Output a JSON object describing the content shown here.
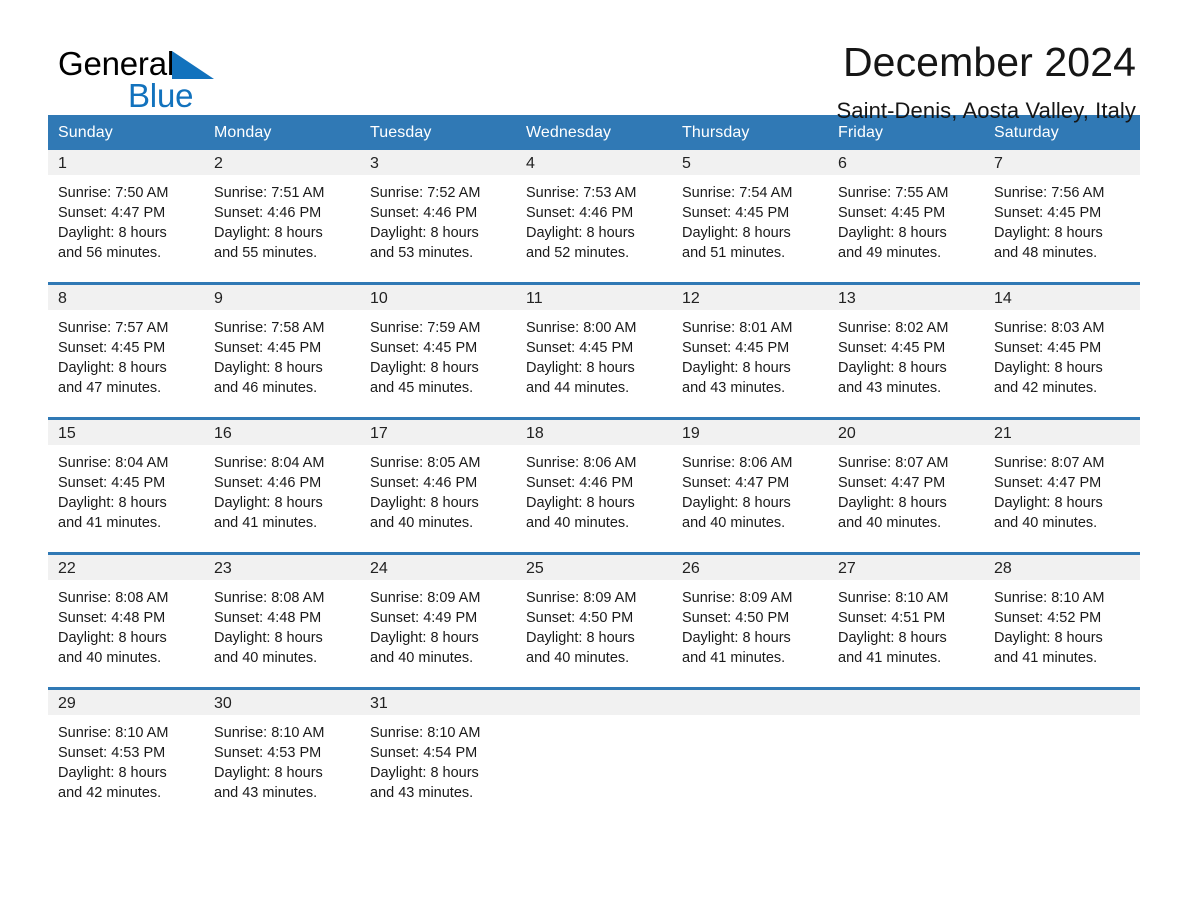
{
  "brand": {
    "name_part1": "General",
    "name_part2": "Blue",
    "accent_color": "#1272bd"
  },
  "header": {
    "title": "December 2024",
    "subtitle": "Saint-Denis, Aosta Valley, Italy"
  },
  "theme": {
    "header_row_color": "#3079b5",
    "day_band_color": "#f1f1f1",
    "rule_color": "#3079b5"
  },
  "calendar": {
    "weekday_headers": [
      "Sunday",
      "Monday",
      "Tuesday",
      "Wednesday",
      "Thursday",
      "Friday",
      "Saturday"
    ],
    "weeks": [
      [
        {
          "day": "1",
          "sunrise": "Sunrise: 7:50 AM",
          "sunset": "Sunset: 4:47 PM",
          "daylight_line1": "Daylight: 8 hours",
          "daylight_line2": "and 56 minutes."
        },
        {
          "day": "2",
          "sunrise": "Sunrise: 7:51 AM",
          "sunset": "Sunset: 4:46 PM",
          "daylight_line1": "Daylight: 8 hours",
          "daylight_line2": "and 55 minutes."
        },
        {
          "day": "3",
          "sunrise": "Sunrise: 7:52 AM",
          "sunset": "Sunset: 4:46 PM",
          "daylight_line1": "Daylight: 8 hours",
          "daylight_line2": "and 53 minutes."
        },
        {
          "day": "4",
          "sunrise": "Sunrise: 7:53 AM",
          "sunset": "Sunset: 4:46 PM",
          "daylight_line1": "Daylight: 8 hours",
          "daylight_line2": "and 52 minutes."
        },
        {
          "day": "5",
          "sunrise": "Sunrise: 7:54 AM",
          "sunset": "Sunset: 4:45 PM",
          "daylight_line1": "Daylight: 8 hours",
          "daylight_line2": "and 51 minutes."
        },
        {
          "day": "6",
          "sunrise": "Sunrise: 7:55 AM",
          "sunset": "Sunset: 4:45 PM",
          "daylight_line1": "Daylight: 8 hours",
          "daylight_line2": "and 49 minutes."
        },
        {
          "day": "7",
          "sunrise": "Sunrise: 7:56 AM",
          "sunset": "Sunset: 4:45 PM",
          "daylight_line1": "Daylight: 8 hours",
          "daylight_line2": "and 48 minutes."
        }
      ],
      [
        {
          "day": "8",
          "sunrise": "Sunrise: 7:57 AM",
          "sunset": "Sunset: 4:45 PM",
          "daylight_line1": "Daylight: 8 hours",
          "daylight_line2": "and 47 minutes."
        },
        {
          "day": "9",
          "sunrise": "Sunrise: 7:58 AM",
          "sunset": "Sunset: 4:45 PM",
          "daylight_line1": "Daylight: 8 hours",
          "daylight_line2": "and 46 minutes."
        },
        {
          "day": "10",
          "sunrise": "Sunrise: 7:59 AM",
          "sunset": "Sunset: 4:45 PM",
          "daylight_line1": "Daylight: 8 hours",
          "daylight_line2": "and 45 minutes."
        },
        {
          "day": "11",
          "sunrise": "Sunrise: 8:00 AM",
          "sunset": "Sunset: 4:45 PM",
          "daylight_line1": "Daylight: 8 hours",
          "daylight_line2": "and 44 minutes."
        },
        {
          "day": "12",
          "sunrise": "Sunrise: 8:01 AM",
          "sunset": "Sunset: 4:45 PM",
          "daylight_line1": "Daylight: 8 hours",
          "daylight_line2": "and 43 minutes."
        },
        {
          "day": "13",
          "sunrise": "Sunrise: 8:02 AM",
          "sunset": "Sunset: 4:45 PM",
          "daylight_line1": "Daylight: 8 hours",
          "daylight_line2": "and 43 minutes."
        },
        {
          "day": "14",
          "sunrise": "Sunrise: 8:03 AM",
          "sunset": "Sunset: 4:45 PM",
          "daylight_line1": "Daylight: 8 hours",
          "daylight_line2": "and 42 minutes."
        }
      ],
      [
        {
          "day": "15",
          "sunrise": "Sunrise: 8:04 AM",
          "sunset": "Sunset: 4:45 PM",
          "daylight_line1": "Daylight: 8 hours",
          "daylight_line2": "and 41 minutes."
        },
        {
          "day": "16",
          "sunrise": "Sunrise: 8:04 AM",
          "sunset": "Sunset: 4:46 PM",
          "daylight_line1": "Daylight: 8 hours",
          "daylight_line2": "and 41 minutes."
        },
        {
          "day": "17",
          "sunrise": "Sunrise: 8:05 AM",
          "sunset": "Sunset: 4:46 PM",
          "daylight_line1": "Daylight: 8 hours",
          "daylight_line2": "and 40 minutes."
        },
        {
          "day": "18",
          "sunrise": "Sunrise: 8:06 AM",
          "sunset": "Sunset: 4:46 PM",
          "daylight_line1": "Daylight: 8 hours",
          "daylight_line2": "and 40 minutes."
        },
        {
          "day": "19",
          "sunrise": "Sunrise: 8:06 AM",
          "sunset": "Sunset: 4:47 PM",
          "daylight_line1": "Daylight: 8 hours",
          "daylight_line2": "and 40 minutes."
        },
        {
          "day": "20",
          "sunrise": "Sunrise: 8:07 AM",
          "sunset": "Sunset: 4:47 PM",
          "daylight_line1": "Daylight: 8 hours",
          "daylight_line2": "and 40 minutes."
        },
        {
          "day": "21",
          "sunrise": "Sunrise: 8:07 AM",
          "sunset": "Sunset: 4:47 PM",
          "daylight_line1": "Daylight: 8 hours",
          "daylight_line2": "and 40 minutes."
        }
      ],
      [
        {
          "day": "22",
          "sunrise": "Sunrise: 8:08 AM",
          "sunset": "Sunset: 4:48 PM",
          "daylight_line1": "Daylight: 8 hours",
          "daylight_line2": "and 40 minutes."
        },
        {
          "day": "23",
          "sunrise": "Sunrise: 8:08 AM",
          "sunset": "Sunset: 4:48 PM",
          "daylight_line1": "Daylight: 8 hours",
          "daylight_line2": "and 40 minutes."
        },
        {
          "day": "24",
          "sunrise": "Sunrise: 8:09 AM",
          "sunset": "Sunset: 4:49 PM",
          "daylight_line1": "Daylight: 8 hours",
          "daylight_line2": "and 40 minutes."
        },
        {
          "day": "25",
          "sunrise": "Sunrise: 8:09 AM",
          "sunset": "Sunset: 4:50 PM",
          "daylight_line1": "Daylight: 8 hours",
          "daylight_line2": "and 40 minutes."
        },
        {
          "day": "26",
          "sunrise": "Sunrise: 8:09 AM",
          "sunset": "Sunset: 4:50 PM",
          "daylight_line1": "Daylight: 8 hours",
          "daylight_line2": "and 41 minutes."
        },
        {
          "day": "27",
          "sunrise": "Sunrise: 8:10 AM",
          "sunset": "Sunset: 4:51 PM",
          "daylight_line1": "Daylight: 8 hours",
          "daylight_line2": "and 41 minutes."
        },
        {
          "day": "28",
          "sunrise": "Sunrise: 8:10 AM",
          "sunset": "Sunset: 4:52 PM",
          "daylight_line1": "Daylight: 8 hours",
          "daylight_line2": "and 41 minutes."
        }
      ],
      [
        {
          "day": "29",
          "sunrise": "Sunrise: 8:10 AM",
          "sunset": "Sunset: 4:53 PM",
          "daylight_line1": "Daylight: 8 hours",
          "daylight_line2": "and 42 minutes."
        },
        {
          "day": "30",
          "sunrise": "Sunrise: 8:10 AM",
          "sunset": "Sunset: 4:53 PM",
          "daylight_line1": "Daylight: 8 hours",
          "daylight_line2": "and 43 minutes."
        },
        {
          "day": "31",
          "sunrise": "Sunrise: 8:10 AM",
          "sunset": "Sunset: 4:54 PM",
          "daylight_line1": "Daylight: 8 hours",
          "daylight_line2": "and 43 minutes."
        },
        {
          "day": "",
          "sunrise": "",
          "sunset": "",
          "daylight_line1": "",
          "daylight_line2": ""
        },
        {
          "day": "",
          "sunrise": "",
          "sunset": "",
          "daylight_line1": "",
          "daylight_line2": ""
        },
        {
          "day": "",
          "sunrise": "",
          "sunset": "",
          "daylight_line1": "",
          "daylight_line2": ""
        },
        {
          "day": "",
          "sunrise": "",
          "sunset": "",
          "daylight_line1": "",
          "daylight_line2": ""
        }
      ]
    ]
  }
}
